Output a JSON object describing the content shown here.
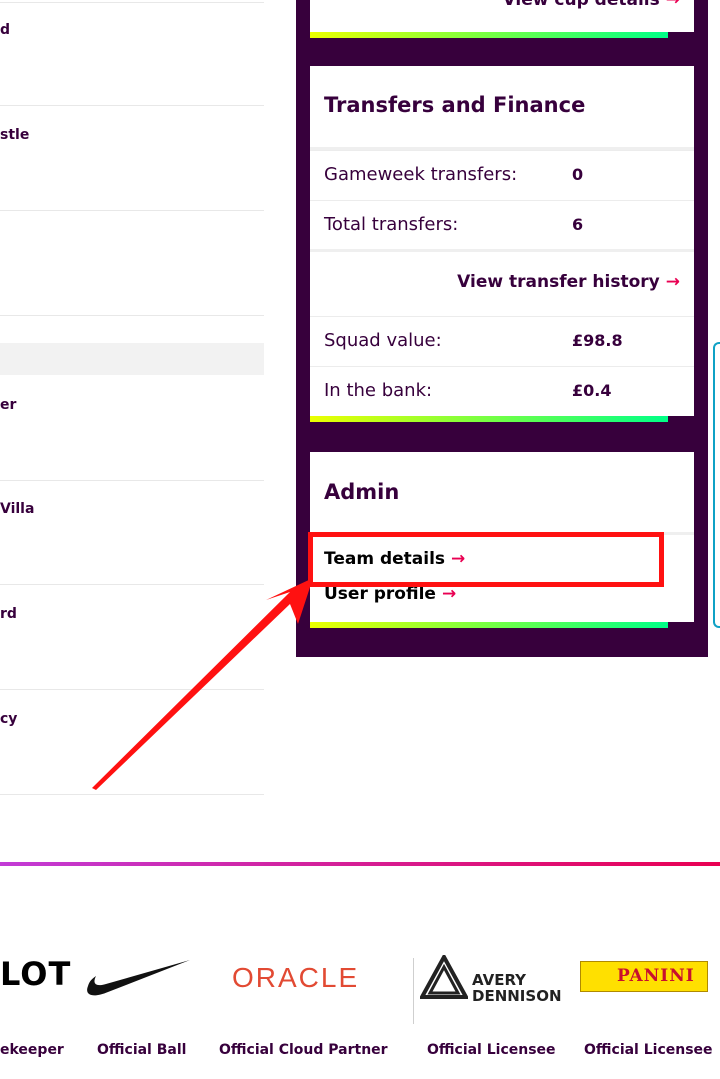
{
  "fixtures": [
    {
      "name": "d"
    },
    {
      "name": "stle"
    },
    {
      "name": ""
    },
    {
      "name": "er"
    },
    {
      "name": "Villa"
    },
    {
      "name": "rd"
    },
    {
      "name": "cy"
    }
  ],
  "cup": {
    "link_label": "View cup details"
  },
  "transfers": {
    "title": "Transfers and Finance",
    "gameweek_label": "Gameweek transfers:",
    "gameweek_value": "0",
    "total_label": "Total transfers:",
    "total_value": "6",
    "history_link": "View transfer history",
    "squad_label": "Squad value:",
    "squad_value": "£98.8",
    "bank_label": "In the bank:",
    "bank_value": "£0.4"
  },
  "admin": {
    "title": "Admin",
    "team_details": "Team details",
    "user_profile": "User profile"
  },
  "arrow_glyph": "→",
  "partners": [
    {
      "logo_text": "LOT",
      "label": "ekeeper"
    },
    {
      "logo_icon": "nike-swoosh-icon",
      "label": "Official Ball"
    },
    {
      "logo_text": "ORACLE",
      "label": "Official Cloud Partner"
    },
    {
      "logo_text": "AVERY DENNISON",
      "label": "Official Licensee"
    },
    {
      "logo_text": "PANINI",
      "label": "Official Licensee"
    }
  ],
  "colors": {
    "primary": "#37003c",
    "accent_link": "#e90052",
    "annotation": "#ff1111"
  }
}
